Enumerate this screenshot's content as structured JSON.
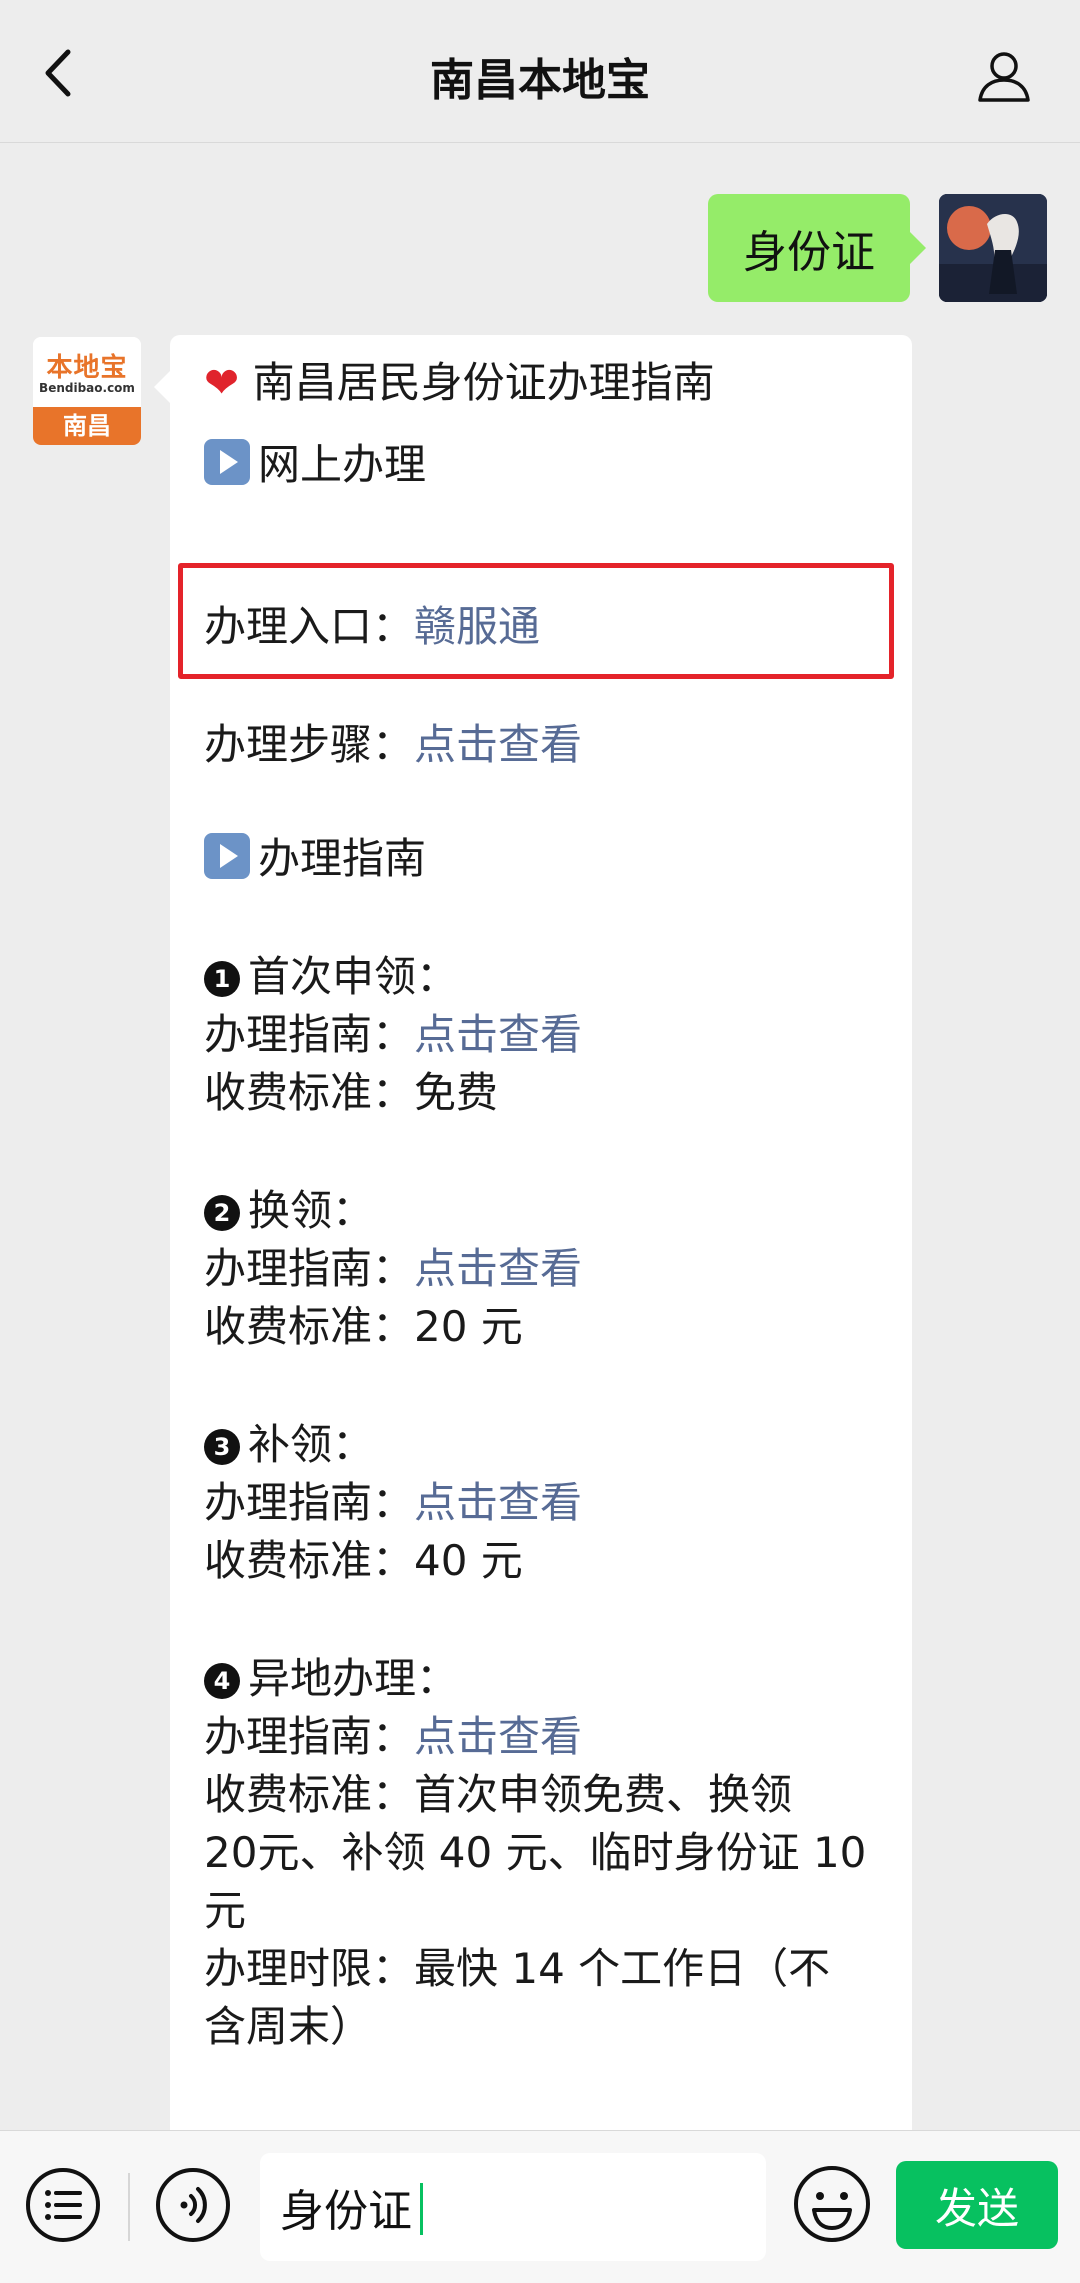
{
  "header": {
    "title": "南昌本地宝"
  },
  "user_message": {
    "text": "身份证"
  },
  "bot_avatar": {
    "logo_cn": "本地宝",
    "logo_en": "Bendibao.com",
    "city": "南昌"
  },
  "reply": {
    "title": "南昌居民身份证办理指南",
    "online_section": "网上办理",
    "entry_label": "办理入口：",
    "entry_link": "赣服通",
    "steps_label": "办理步骤：",
    "steps_link": "点击查看",
    "guide_section": "办理指南",
    "items": [
      {
        "number": "1",
        "title": "首次申领：",
        "guide_label": "办理指南：",
        "guide_link": "点击查看",
        "fee_label": "收费标准：",
        "fee": "免费"
      },
      {
        "number": "2",
        "title": "换领：",
        "guide_label": "办理指南：",
        "guide_link": "点击查看",
        "fee_label": "收费标准：",
        "fee": "20 元"
      },
      {
        "number": "3",
        "title": "补领：",
        "guide_label": "办理指南：",
        "guide_link": "点击查看",
        "fee_label": "收费标准：",
        "fee": "40 元"
      },
      {
        "number": "4",
        "title": "异地办理：",
        "guide_label": "办理指南：",
        "guide_link": "点击查看",
        "fee_label": "收费标准：",
        "fee_line1": "首次申领免费、换领",
        "fee_line2": "20元、补领 40 元、临时身份证 10",
        "fee_line3": "元",
        "time_label": "办理时限：",
        "time_line1": "最快 14 个工作日（不",
        "time_line2": "含周末）"
      }
    ]
  },
  "input_bar": {
    "value": "身份证",
    "send_label": "发送"
  }
}
